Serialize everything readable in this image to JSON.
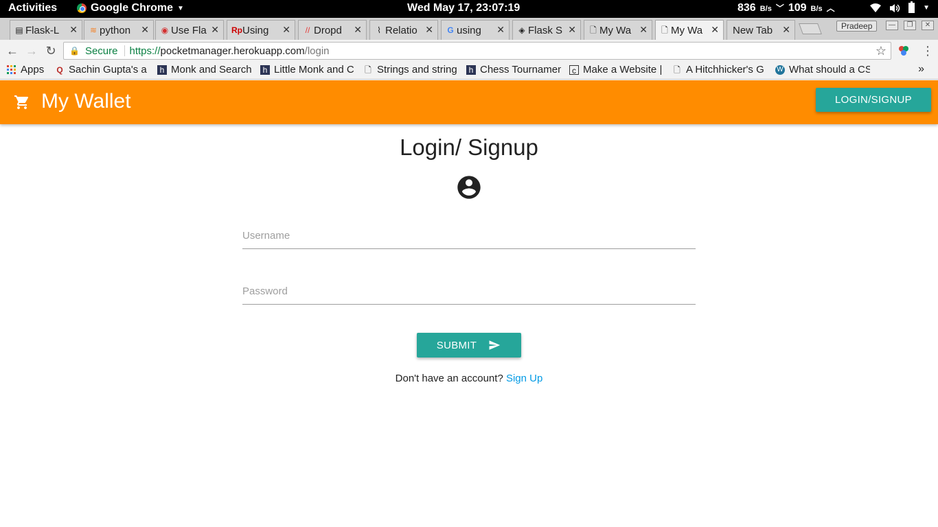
{
  "os_bar": {
    "activities": "Activities",
    "app_name": "Google Chrome",
    "clock": "Wed May 17, 23:07:19",
    "net_down": "836",
    "net_down_unit": "B/s",
    "net_up": "109",
    "net_up_unit": "B/s"
  },
  "tabs": [
    {
      "label": "Flask-L",
      "icon": "page-icon"
    },
    {
      "label": "python",
      "icon": "stackoverflow-icon"
    },
    {
      "label": "Use Fla",
      "icon": "redhat-icon"
    },
    {
      "label": "Using",
      "icon": "rp-icon"
    },
    {
      "label": "Dropd",
      "icon": "dropdown-icon"
    },
    {
      "label": "Relatio",
      "icon": "graph-icon"
    },
    {
      "label": "using",
      "icon": "google-icon"
    },
    {
      "label": "Flask S",
      "icon": "diamond-icon"
    },
    {
      "label": "My Wa",
      "icon": "page-icon"
    },
    {
      "label": "My Wa",
      "icon": "page-icon"
    },
    {
      "label": "New Tab",
      "icon": ""
    }
  ],
  "profile_name": "Pradeep",
  "omnibox": {
    "secure_label": "Secure",
    "scheme": "https://",
    "host": "pocketmanager.herokuapp.com",
    "path": "/login"
  },
  "bookmarks": [
    {
      "label": "Apps"
    },
    {
      "label": "Sachin Gupta's a"
    },
    {
      "label": "Monk and Search"
    },
    {
      "label": "Little Monk and C"
    },
    {
      "label": "Strings and string"
    },
    {
      "label": "Chess Tournamen"
    },
    {
      "label": "Make a Website |"
    },
    {
      "label": "A Hitchhicker's G"
    },
    {
      "label": "What should a CS"
    }
  ],
  "bookmarks_more": "»",
  "app": {
    "brand": "My Wallet",
    "login_button": "LOGIN/SIGNUP",
    "brand_color": "#ff8c00",
    "accent_color": "#26a69a"
  },
  "login": {
    "title": "Login/ Signup",
    "username_placeholder": "Username",
    "password_placeholder": "Password",
    "submit_label": "SUBMIT",
    "no_account_text": "Don't have an account?",
    "signup_link": "Sign Up"
  }
}
